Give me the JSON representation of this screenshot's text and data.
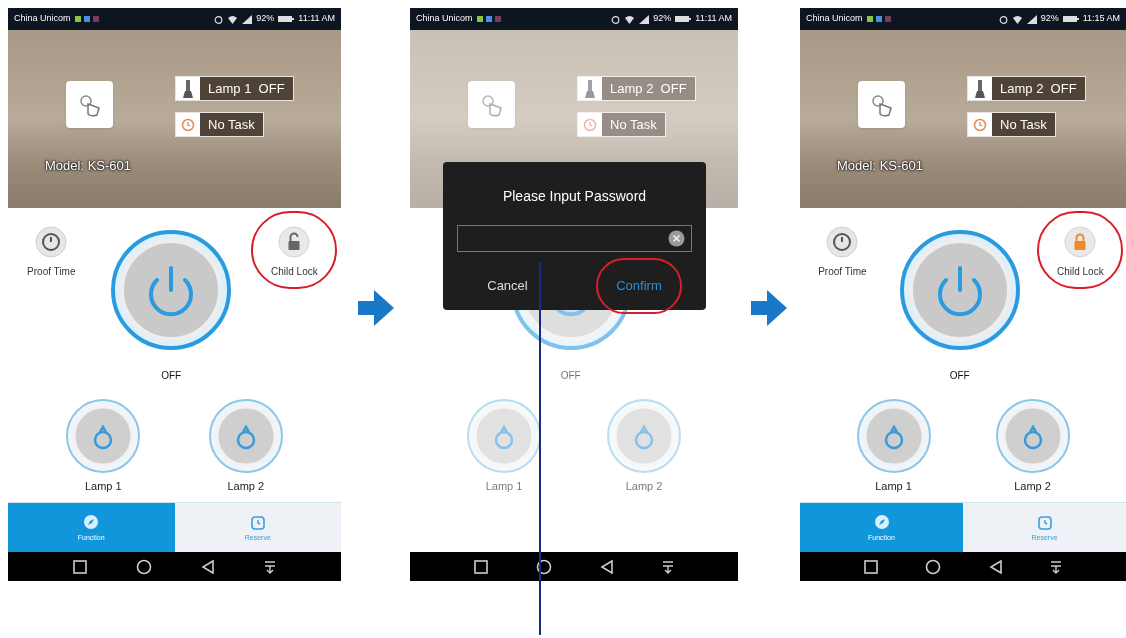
{
  "phones": [
    {
      "status_bar": {
        "carrier": "China Unicom",
        "battery": "92%",
        "time": "11:11 AM"
      },
      "dimmed": false,
      "header": {
        "lamp_status": "Lamp 1  OFF",
        "task": "No Task",
        "model": "Model: KS-601"
      },
      "controls": {
        "proof_time": {
          "label": "Proof Time"
        },
        "child_lock": {
          "label": "Child Lock",
          "locked": false,
          "highlighted": true
        },
        "power_state": "OFF"
      },
      "lamps": [
        {
          "label": "Lamp 1"
        },
        {
          "label": "Lamp 2"
        }
      ],
      "tabs": [
        {
          "label": "Function",
          "selected": true
        },
        {
          "label": "Reserve",
          "selected": false
        }
      ]
    },
    {
      "status_bar": {
        "carrier": "China Unicom",
        "battery": "92%",
        "time": "11:11 AM"
      },
      "dimmed": true,
      "header": {
        "lamp_status": "Lamp 2  OFF",
        "task": "No Task"
      },
      "controls": {
        "power_state": "OFF"
      },
      "lamps": [
        {
          "label": "Lamp 1"
        },
        {
          "label": "Lamp 2"
        }
      ],
      "dialog": {
        "title": "Please Input Password",
        "cancel": "Cancel",
        "confirm": "Confirm",
        "confirm_highlighted": true
      }
    },
    {
      "status_bar": {
        "carrier": "China Unicom",
        "battery": "92%",
        "time": "11:15 AM"
      },
      "dimmed": false,
      "header": {
        "lamp_status": "Lamp 2  OFF",
        "task": "No Task",
        "model": "Model: KS-601"
      },
      "controls": {
        "proof_time": {
          "label": "Proof Time"
        },
        "child_lock": {
          "label": "Child Lock",
          "locked": true,
          "highlighted": true
        },
        "power_state": "OFF"
      },
      "lamps": [
        {
          "label": "Lamp 1"
        },
        {
          "label": "Lamp 2"
        }
      ],
      "tabs": [
        {
          "label": "Function",
          "selected": true
        },
        {
          "label": "Reserve",
          "selected": false
        }
      ]
    }
  ]
}
